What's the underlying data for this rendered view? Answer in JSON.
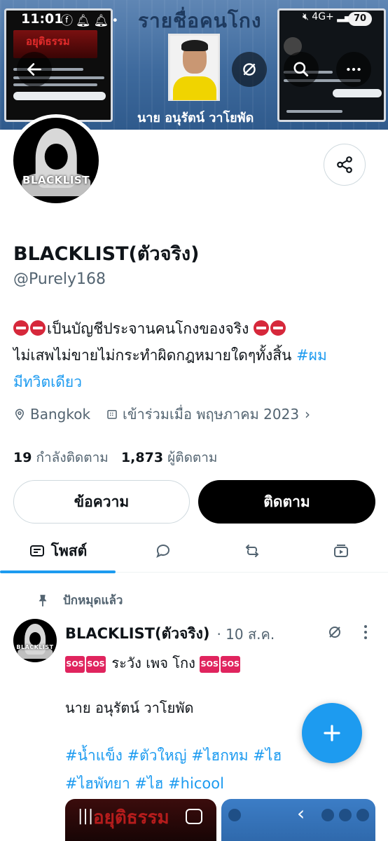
{
  "status_bar": {
    "time": "11:01",
    "network": "4G+",
    "battery": "70"
  },
  "banner": {
    "title": "รายชื่อคนโกง",
    "caption": "นาย อนุรัตน์ วาโยพัด",
    "left_shot_text": "อยุติธรรม"
  },
  "profile": {
    "display_name": "BLACKLIST(ตัวจริง)",
    "handle": "@Purely168",
    "avatar_text": "BLACKLIST",
    "bio_line1": "เป็นบัญชีประจานคนโกงของจริง",
    "bio_line2": "ไม่เสพไม่ขายไม่กระทำผิดกฎหมายใดๆทั้งสิ้น",
    "bio_tag_part1": "#ผม",
    "bio_tag_part2": "มีทวิตเดียว",
    "location": "Bangkok",
    "joined": "เข้าร่วมเมื่อ พฤษภาคม 2023",
    "following_count": "19",
    "following_label": "กำลังติดตาม",
    "followers_count": "1,873",
    "followers_label": "ผู้ติดตาม"
  },
  "buttons": {
    "message": "ข้อความ",
    "follow": "ติดตาม"
  },
  "tabs": {
    "posts": "โพสต์"
  },
  "pinned_post": {
    "pinned_label": "ปักหมุดแล้ว",
    "author": "BLACKLIST(ตัวจริง)",
    "time": "· 10 ส.ค.",
    "sos_label": "SOS",
    "line1": "ระวัง เพจ โกง",
    "line2": "นาย อนุรัตน์ วาโยพัด",
    "tags_line1": "#น้ำแข็ง #ตัวใหญ่ #ไฮกทม #ไฮ",
    "tags_line2": "#ไฮพัทยา #ไฮ #hicool",
    "thumb_text": "อยุติธรรม"
  },
  "colors": {
    "accent": "#1d9bf0",
    "secondary_text": "#536471",
    "border": "#cfd9de"
  }
}
